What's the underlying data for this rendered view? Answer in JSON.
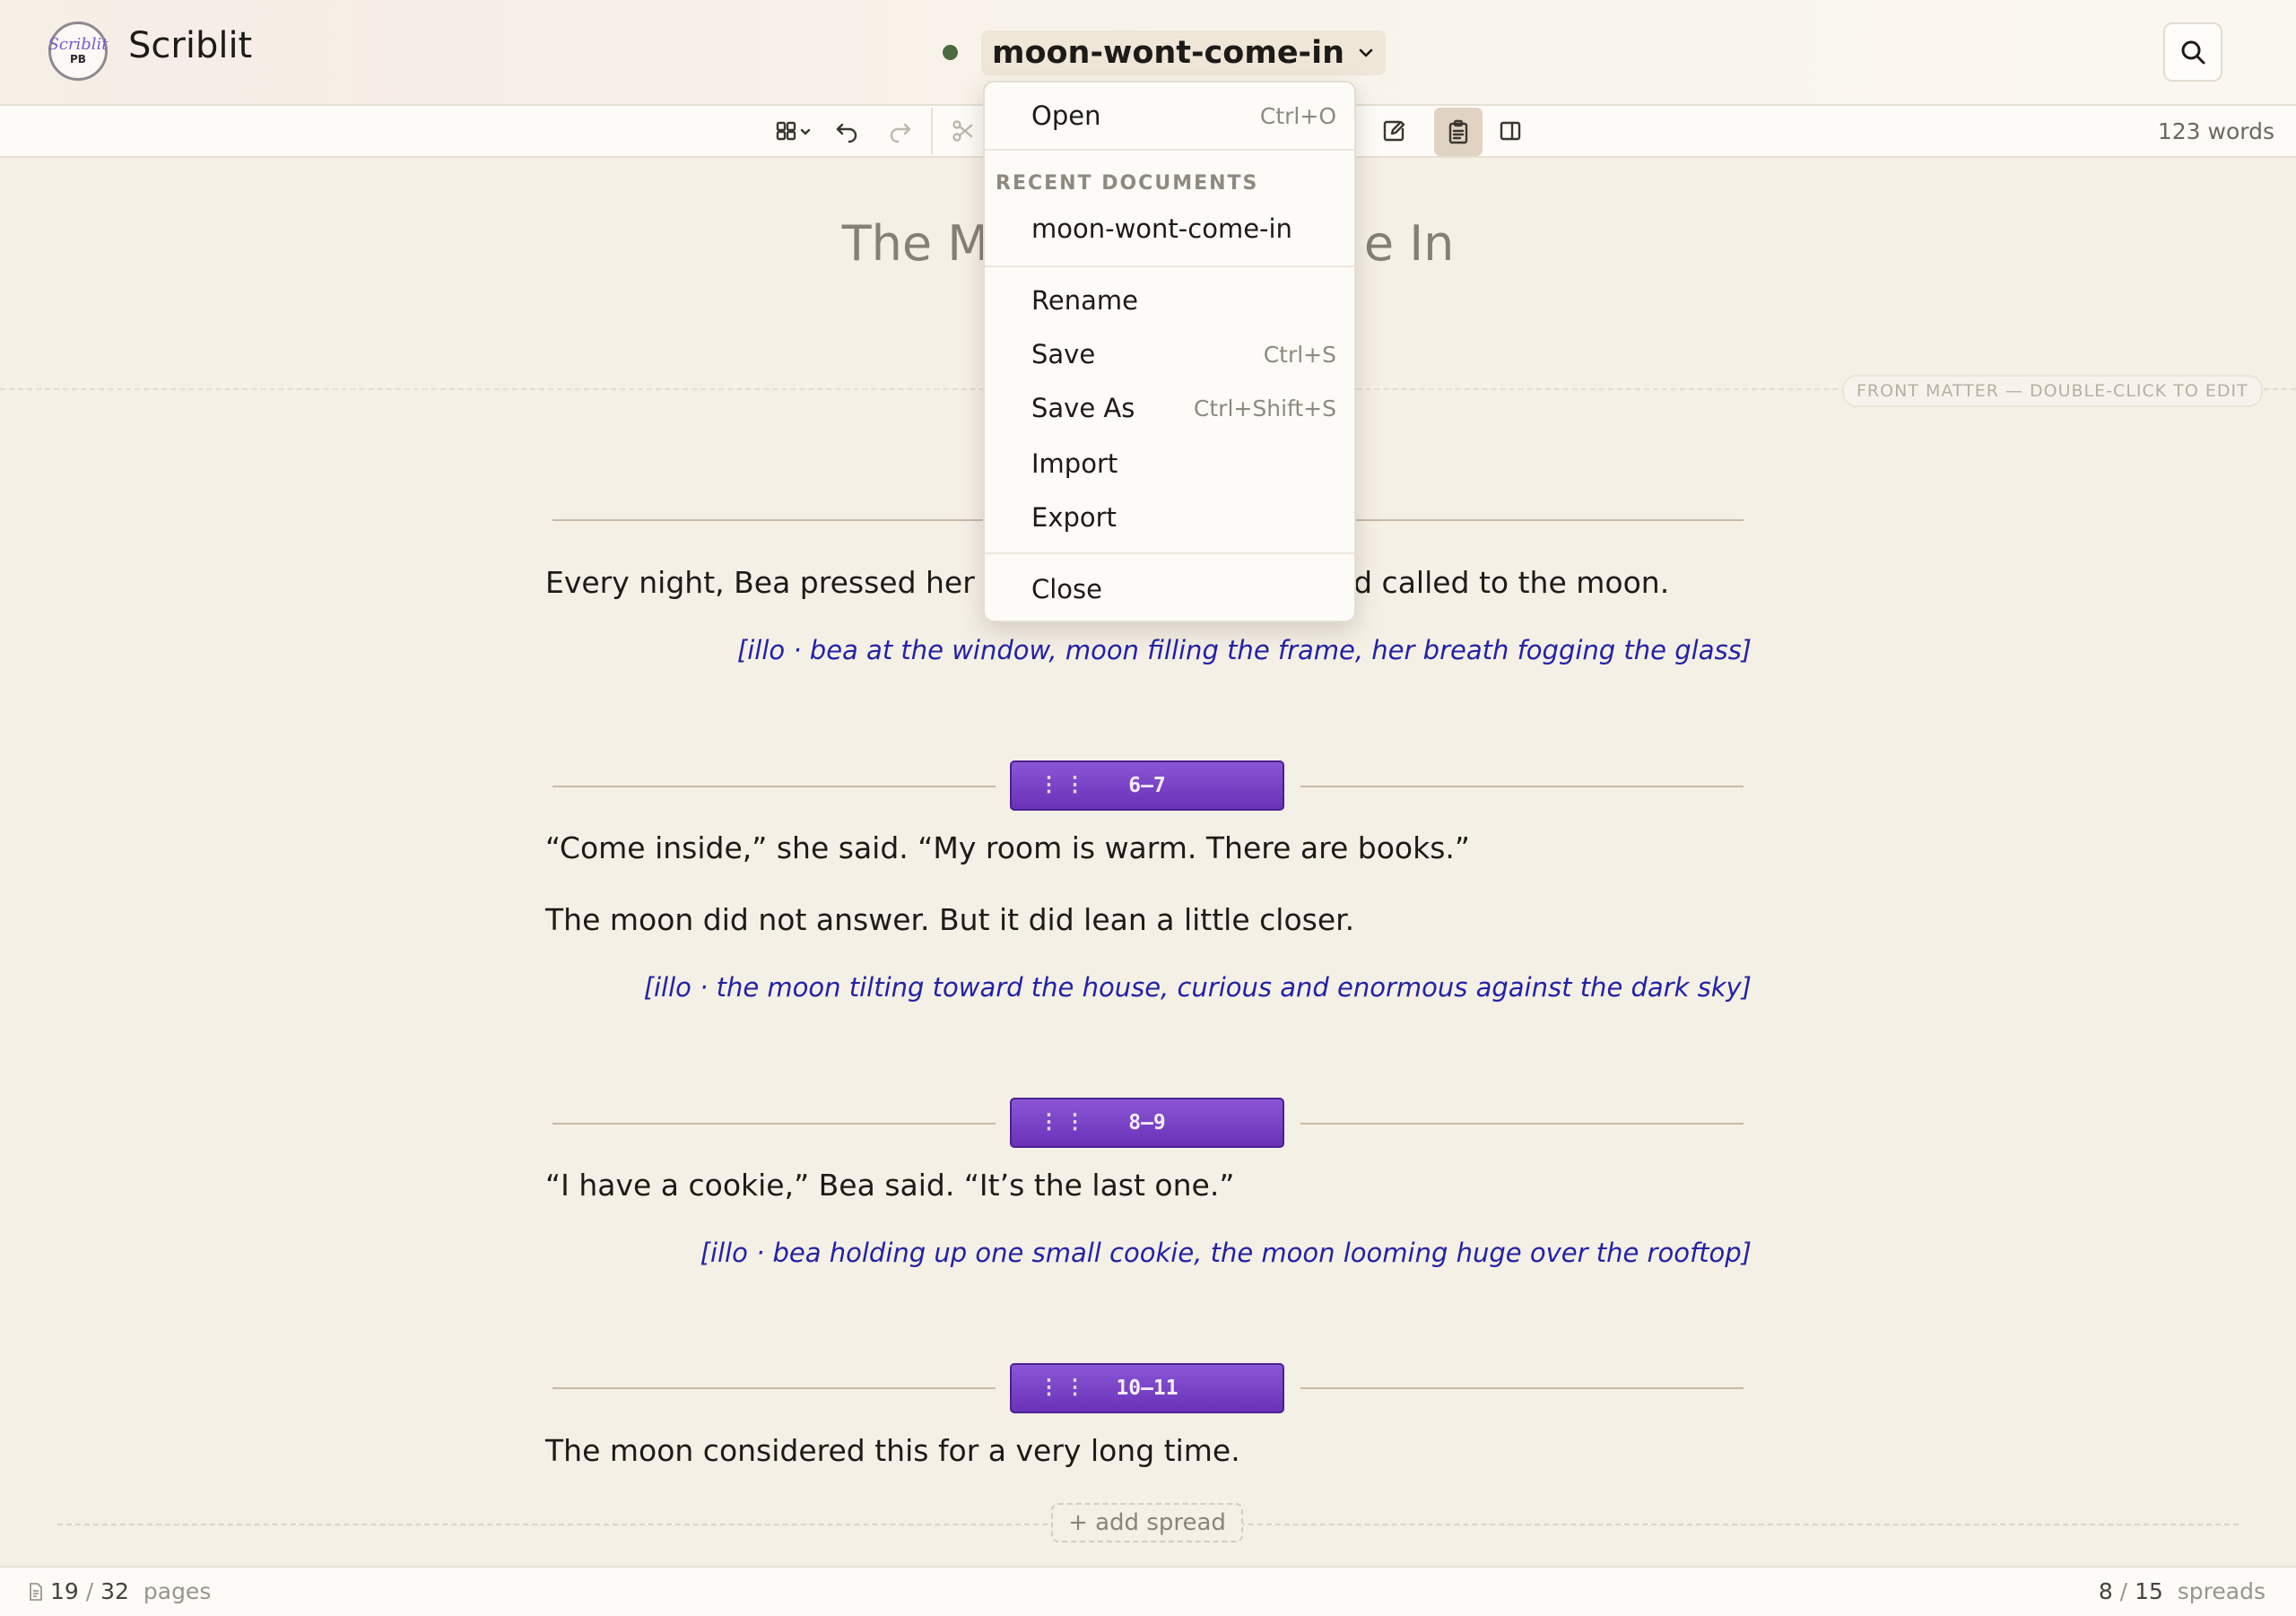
{
  "app": {
    "name": "Scriblit",
    "logo_script": "Scriblit",
    "logo_badge": "PB"
  },
  "document": {
    "name": "moon-wont-come-in",
    "status_color": "#4a6b3f"
  },
  "header": {
    "search_icon": "search-icon",
    "chevron_icon": "chevron-down-icon"
  },
  "toolbar": {
    "word_count": "123 words",
    "icons": [
      "grid-view-icon",
      "undo-icon",
      "redo-icon",
      "cut-icon",
      "edit-note-icon",
      "clipboard-icon",
      "sidebar-icon"
    ]
  },
  "menu": {
    "open": {
      "label": "Open",
      "shortcut": "Ctrl+O"
    },
    "recent_header": "RECENT DOCUMENTS",
    "recent": [
      "moon-wont-come-in"
    ],
    "rename": {
      "label": "Rename"
    },
    "save": {
      "label": "Save",
      "shortcut": "Ctrl+S"
    },
    "save_as": {
      "label": "Save As",
      "shortcut": "Ctrl+Shift+S"
    },
    "import": {
      "label": "Import"
    },
    "export": {
      "label": "Export"
    },
    "close": {
      "label": "Close"
    }
  },
  "manuscript": {
    "title_left": "The M",
    "title_right": "e In",
    "front_matter_label": "FRONT MATTER — DOUBLE-CLICK TO EDIT",
    "spread_a": {
      "text_left": "Every night, Bea pressed her n",
      "text_right": "nd called to the moon.",
      "illo": "[illo · bea at the window, moon filling the frame, her breath fogging the glass]"
    },
    "spread_b": {
      "range": "6–7",
      "text1": "“Come inside,” she said. “My room is warm. There are books.”",
      "text2": "The moon did not answer. But it did lean a little closer.",
      "illo": "[illo · the moon tilting toward the house, curious and enormous against the dark sky]"
    },
    "spread_c": {
      "range": "8–9",
      "text1": "“I have a cookie,” Bea said. “It’s the last one.”",
      "illo": "[illo · bea holding up one small cookie, the moon looming huge over the rooftop]"
    },
    "spread_d": {
      "range": "10–11",
      "text1": "The moon considered this for a very long time."
    },
    "grip": "⋮⋮",
    "add_spread": "+ add spread"
  },
  "status": {
    "pages_current": "19",
    "pages_sep": "/",
    "pages_total": "32",
    "pages_label": "pages",
    "spreads_current": "8",
    "spreads_sep": "/",
    "spreads_total": "15",
    "spreads_label": "spreads"
  },
  "colors": {
    "accent": "#6a32b8",
    "illo_text": "#2222a6",
    "background": "#f5f0e6"
  }
}
